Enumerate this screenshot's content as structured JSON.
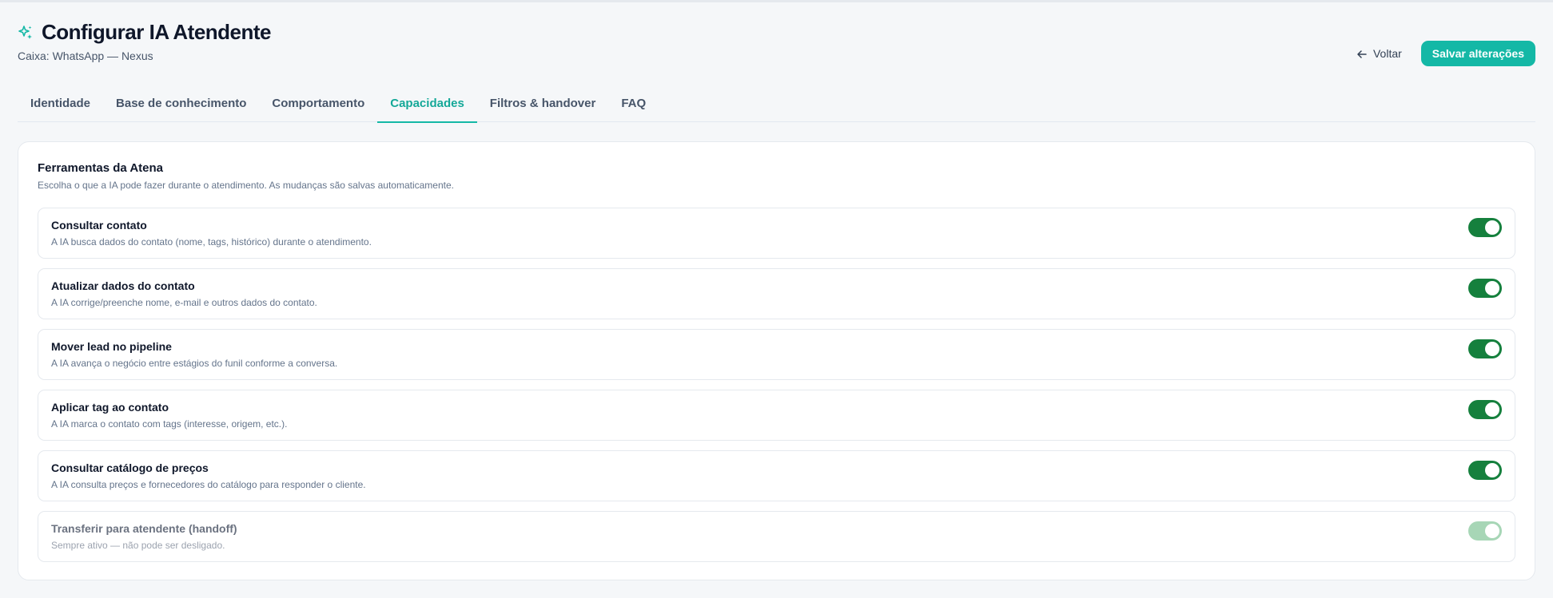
{
  "header": {
    "title": "Configurar IA Atendente",
    "subtitle": "Caixa: WhatsApp — Nexus",
    "icon": "sparkles-icon",
    "accent_color": "#14b8a6"
  },
  "actions": {
    "back_label": "Voltar",
    "save_label": "Salvar alterações"
  },
  "tabs": [
    {
      "label": "Identidade",
      "active": false
    },
    {
      "label": "Base de conhecimento",
      "active": false
    },
    {
      "label": "Comportamento",
      "active": false
    },
    {
      "label": "Capacidades",
      "active": true
    },
    {
      "label": "Filtros & handover",
      "active": false
    },
    {
      "label": "FAQ",
      "active": false
    }
  ],
  "section": {
    "title": "Ferramentas da Atena",
    "description": "Escolha o que a IA pode fazer durante o atendimento. As mudanças são salvas automaticamente."
  },
  "tools": [
    {
      "title": "Consultar contato",
      "description": "A IA busca dados do contato (nome, tags, histórico) durante o atendimento.",
      "enabled": true,
      "locked": false
    },
    {
      "title": "Atualizar dados do contato",
      "description": "A IA corrige/preenche nome, e-mail e outros dados do contato.",
      "enabled": true,
      "locked": false
    },
    {
      "title": "Mover lead no pipeline",
      "description": "A IA avança o negócio entre estágios do funil conforme a conversa.",
      "enabled": true,
      "locked": false
    },
    {
      "title": "Aplicar tag ao contato",
      "description": "A IA marca o contato com tags (interesse, origem, etc.).",
      "enabled": true,
      "locked": false
    },
    {
      "title": "Consultar catálogo de preços",
      "description": "A IA consulta preços e fornecedores do catálogo para responder o cliente.",
      "enabled": true,
      "locked": false
    },
    {
      "title": "Transferir para atendente (handoff)",
      "description": "Sempre ativo — não pode ser desligado.",
      "enabled": true,
      "locked": true
    }
  ],
  "colors": {
    "toggle_on": "#15803d",
    "toggle_locked": "#a7d6b6",
    "save_button": "#14b8a6"
  }
}
